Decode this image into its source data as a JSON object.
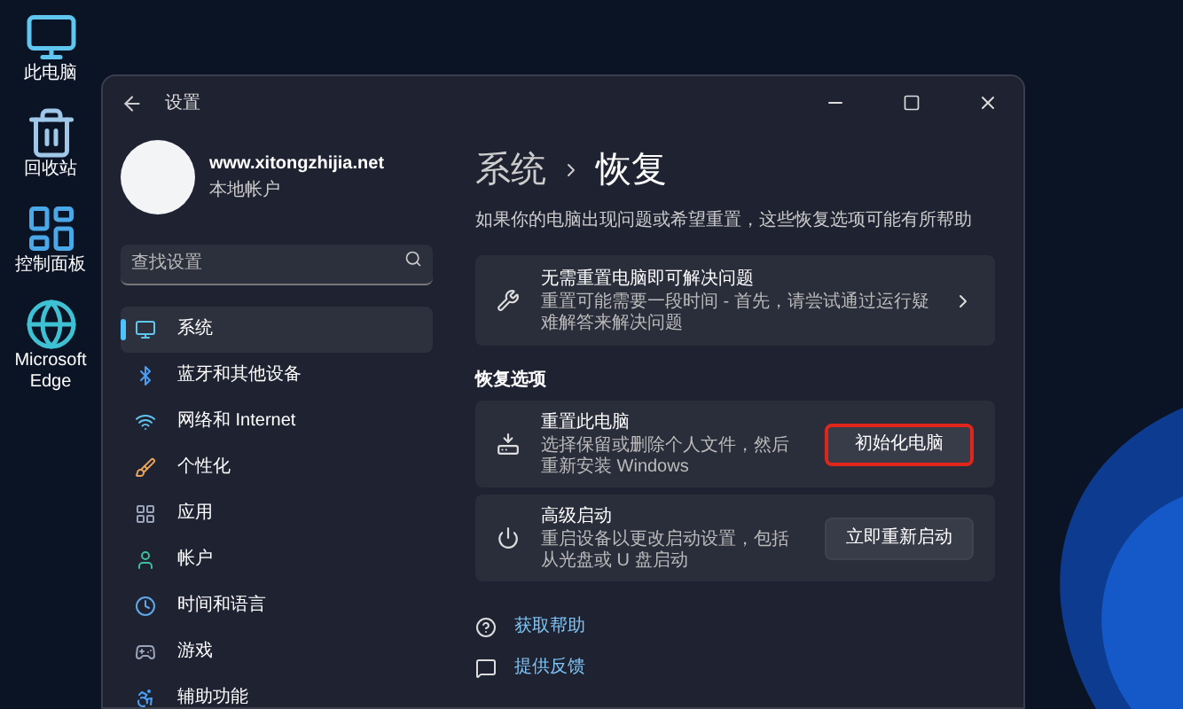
{
  "desktop_icons": [
    {
      "label": "此电脑"
    },
    {
      "label": "回收站"
    },
    {
      "label": "控制面板"
    },
    {
      "label": "Microsoft Edge"
    }
  ],
  "window": {
    "title": "设置"
  },
  "account": {
    "name": "www.xitongzhijia.net",
    "type": "本地帐户"
  },
  "search": {
    "placeholder": "查找设置"
  },
  "nav_items": [
    {
      "label": "系统",
      "selected": true
    },
    {
      "label": "蓝牙和其他设备",
      "selected": false
    },
    {
      "label": "网络和 Internet",
      "selected": false
    },
    {
      "label": "个性化",
      "selected": false
    },
    {
      "label": "应用",
      "selected": false
    },
    {
      "label": "帐户",
      "selected": false
    },
    {
      "label": "时间和语言",
      "selected": false
    },
    {
      "label": "游戏",
      "selected": false
    },
    {
      "label": "辅助功能",
      "selected": false
    }
  ],
  "breadcrumb": {
    "parent": "系统",
    "current": "恢复"
  },
  "subtitle": "如果你的电脑出现问题或希望重置，这些恢复选项可能有所帮助",
  "troubleshoot_card": {
    "title": "无需重置电脑即可解决问题",
    "description": "重置可能需要一段时间 - 首先，请尝试通过运行疑难解答来解决问题"
  },
  "section_title": "恢复选项",
  "options": [
    {
      "title": "重置此电脑",
      "description": "选择保留或删除个人文件，然后重新安装 Windows",
      "button": {
        "label": "初始化电脑",
        "highlighted": true
      }
    },
    {
      "title": "高级启动",
      "description": "重启设备以更改启动设置，包括从光盘或 U 盘启动",
      "button": {
        "label": "立即重新启动",
        "highlighted": false
      }
    }
  ],
  "links": [
    {
      "label": "获取帮助"
    },
    {
      "label": "提供反馈"
    }
  ]
}
